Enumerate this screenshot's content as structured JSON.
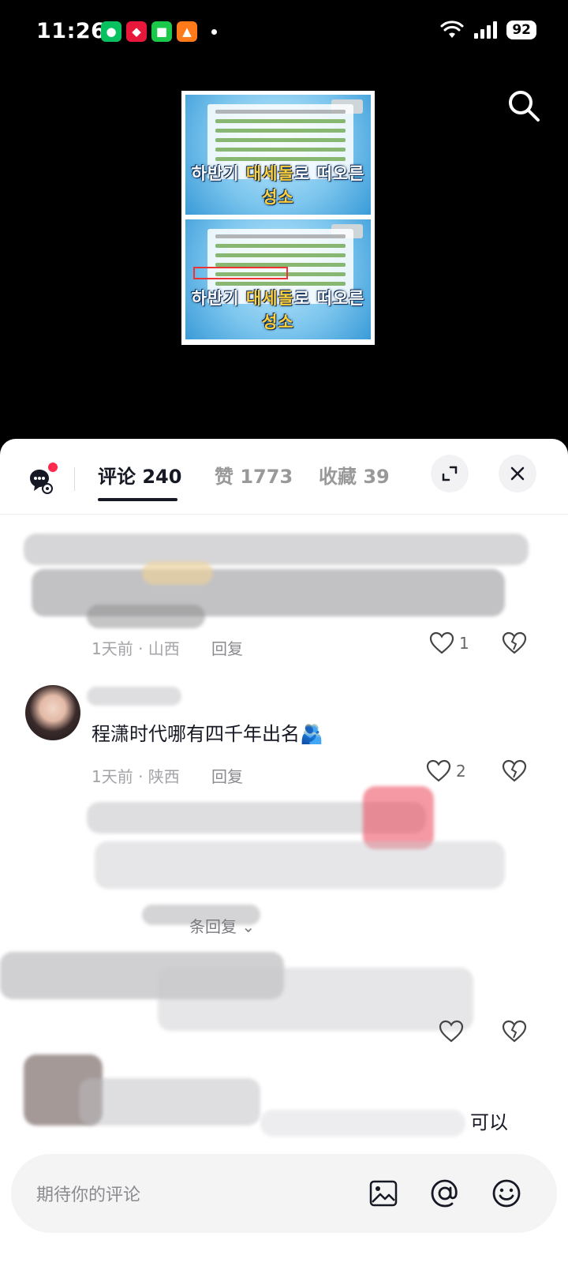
{
  "status_bar": {
    "time": "11:26",
    "battery": "92",
    "apps": [
      "wechat-icon",
      "red-app-icon",
      "green-app-icon",
      "orange-app-icon"
    ]
  },
  "media": {
    "caption_prefix": "하반기 ",
    "caption_highlight": "대세돌",
    "caption_mid": "로 떠오른 ",
    "caption_end": "성소"
  },
  "sheet": {
    "tabs": [
      {
        "label": "评论 240",
        "active": true
      },
      {
        "label": "赞 1773",
        "active": false
      },
      {
        "label": "收藏 39",
        "active": false
      }
    ]
  },
  "comments": [
    {
      "text": "",
      "time_location": "1天前 · 山西",
      "reply_label": "回复",
      "likes": "1"
    },
    {
      "text": "程潇时代哪有四千年出名🫂",
      "time_location": "1天前 · 陕西",
      "reply_label": "回复",
      "likes": "2"
    },
    {
      "expand_label": "条回复"
    },
    {
      "text": "",
      "likes": ""
    },
    {
      "text_tail": "可以"
    }
  ],
  "input": {
    "placeholder": "期待你的评论"
  },
  "colors": {
    "accent": "#161823",
    "red_dot": "#ff2a4d",
    "muted": "#a3a3a8"
  }
}
